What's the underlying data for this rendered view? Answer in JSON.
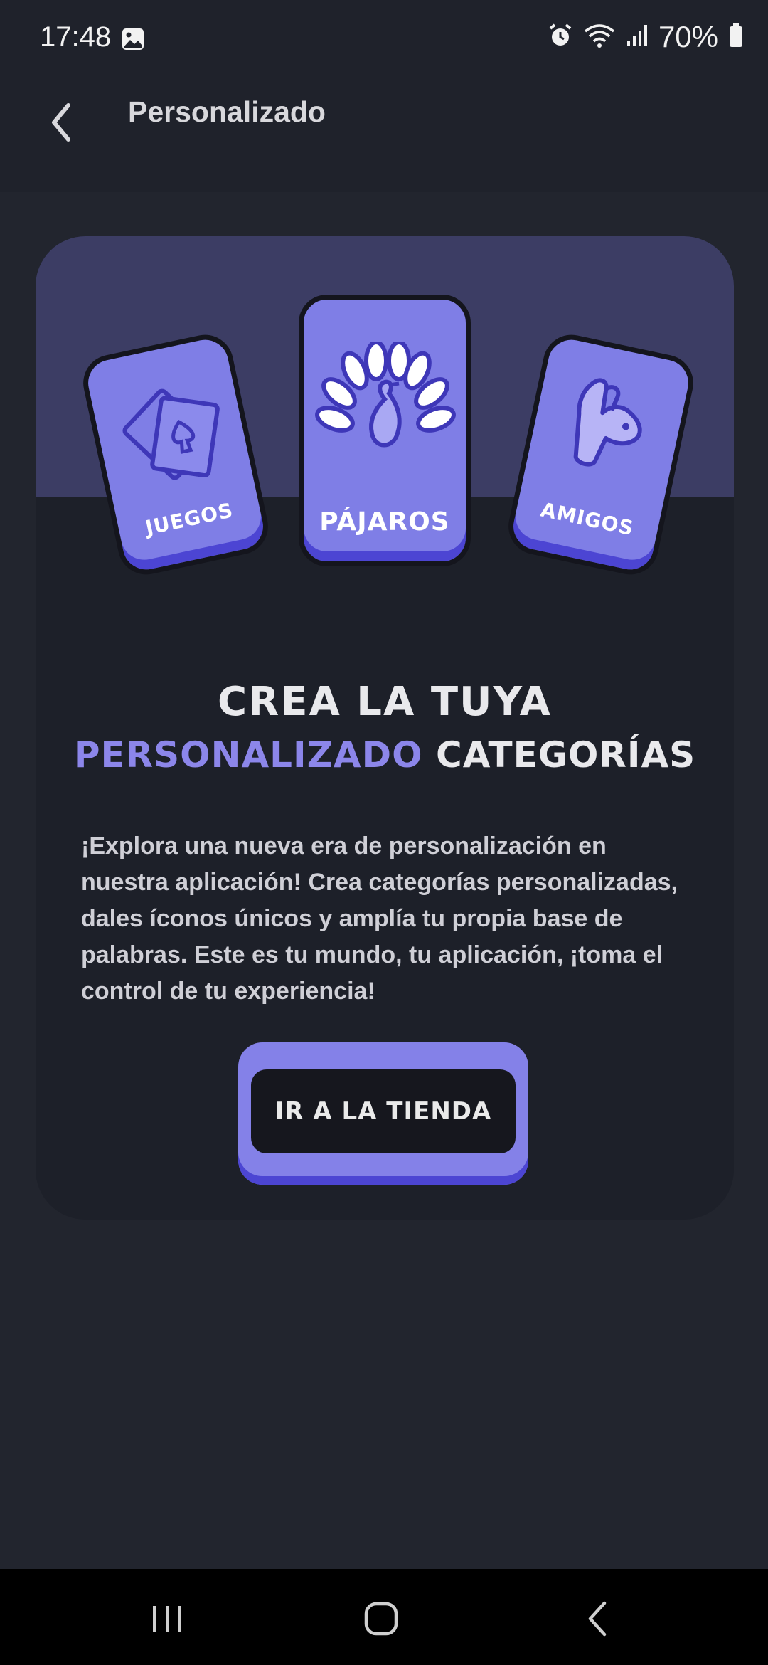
{
  "status_bar": {
    "time": "17:48",
    "battery": "70%",
    "icons": [
      "gallery-icon",
      "alarm-icon",
      "wifi-icon",
      "signal-icon",
      "battery-icon"
    ]
  },
  "app_bar": {
    "title": "Personalizado",
    "back_icon": "chevron-left-icon"
  },
  "promo": {
    "categories": [
      {
        "label": "JUEGOS",
        "icon": "playing-card-icon"
      },
      {
        "label": "PÁJAROS",
        "icon": "peacock-icon"
      },
      {
        "label": "AMIGOS",
        "icon": "hand-dog-icon"
      }
    ],
    "headline_line1": "CREA LA TUYA",
    "headline_accent": "PERSONALIZADO",
    "headline_rest": "CATEGORÍAS",
    "description": "¡Explora una nueva era de personalización en nuestra aplicación! Crea categorías personalizadas, dales íconos únicos y amplía tu propia base de palabras. Este es tu mundo, tu aplicación, ¡toma el control de tu experiencia!",
    "store_button": "IR A LA TIENDA"
  },
  "nav_bar": {
    "items": [
      "recent-apps-icon",
      "home-icon",
      "back-icon"
    ]
  },
  "colors": {
    "background": "#22252e",
    "card": "#1d2029",
    "banner": "#3c3d64",
    "accent": "#7f7ee6",
    "accent_dark": "#4c45d3"
  }
}
